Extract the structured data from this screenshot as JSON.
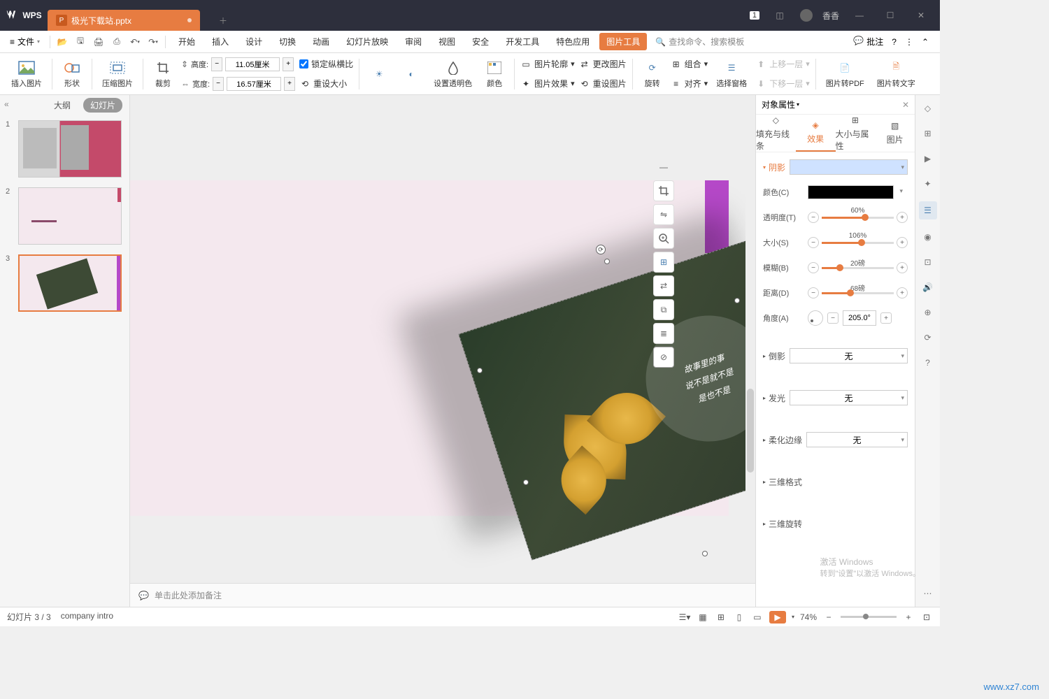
{
  "app": {
    "name": "WPS",
    "user": "香香",
    "badge": "1"
  },
  "tab": {
    "filename": "极光下载站.pptx"
  },
  "menu": {
    "file": "文件",
    "items": [
      "开始",
      "插入",
      "设计",
      "切换",
      "动画",
      "幻灯片放映",
      "审阅",
      "视图",
      "安全",
      "开发工具",
      "特色应用",
      "图片工具"
    ],
    "active": "图片工具",
    "search_placeholder": "查找命令、搜索模板",
    "annotate": "批注"
  },
  "ribbon": {
    "insert_pic": "插入图片",
    "shape": "形状",
    "compress": "压缩图片",
    "crop": "裁剪",
    "height_lbl": "高度:",
    "height": "11.05厘米",
    "width_lbl": "宽度:",
    "width": "16.57厘米",
    "lock_ratio": "锁定纵横比",
    "reset_size": "重设大小",
    "set_transparent": "设置透明色",
    "color": "颜色",
    "outline": "图片轮廓",
    "change": "更改图片",
    "effect": "图片效果",
    "reset_pic": "重设图片",
    "rotate": "旋转",
    "group": "组合",
    "align": "对齐",
    "sel_pane": "选择窗格",
    "up_layer": "上移一层",
    "down_layer": "下移一层",
    "to_pdf": "图片转PDF",
    "to_text": "图片转文字"
  },
  "views": {
    "outline": "大纲",
    "slides": "幻灯片"
  },
  "slides": {
    "count": 3,
    "current": 3
  },
  "photo_text": [
    "故事里的事",
    "说不是就不是",
    "是也不是"
  ],
  "notes_placeholder": "单击此处添加备注",
  "props": {
    "title": "对象属性",
    "tabs": {
      "fill": "填充与线条",
      "effect": "效果",
      "size": "大小与属性",
      "pic": "图片"
    },
    "shadow": {
      "section": "阴影",
      "preset": "",
      "color_lbl": "颜色(C)",
      "transparency_lbl": "透明度(T)",
      "transparency_val": "60%",
      "size_lbl": "大小(S)",
      "size_val": "106%",
      "blur_lbl": "模糊(B)",
      "blur_val": "20磅",
      "distance_lbl": "距离(D)",
      "distance_val": "68磅",
      "angle_lbl": "角度(A)",
      "angle_val": "205.0°"
    },
    "reflection": {
      "lbl": "倒影",
      "val": "无"
    },
    "glow": {
      "lbl": "发光",
      "val": "无"
    },
    "soft_edge": {
      "lbl": "柔化边缘",
      "val": "无"
    },
    "threed_fmt": "三维格式",
    "threed_rot": "三维旋转"
  },
  "status": {
    "page": "幻灯片 3 / 3",
    "note": "company intro",
    "zoom": "74%"
  },
  "watermark": {
    "line1": "激活 Windows",
    "line2": "转到\"设置\"以激活 Windows。",
    "logo2": "www.xz7.com"
  }
}
